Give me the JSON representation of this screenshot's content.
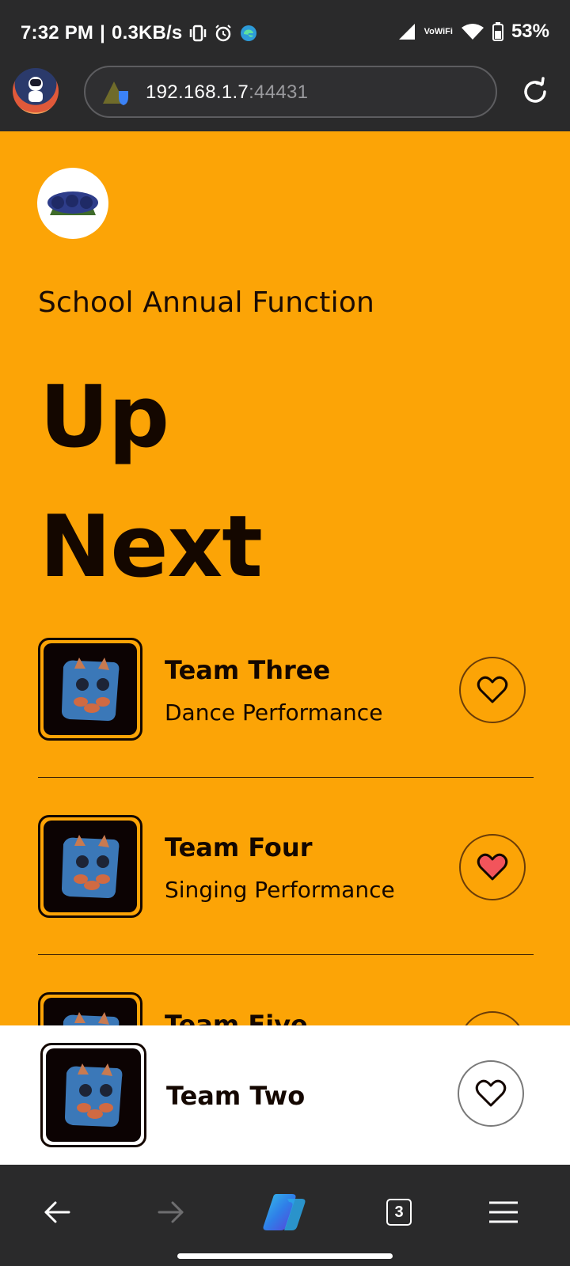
{
  "status_bar": {
    "time": "7:32 PM",
    "speed": "0.3KB/s",
    "volte_top": "Vo",
    "volte_bottom": "WiFi",
    "battery": "53%"
  },
  "browser": {
    "url_host": "192.168.1.7",
    "url_port": ":44431",
    "tab_count": "3"
  },
  "page": {
    "subtitle": "School Annual Function",
    "title_line1": "Up",
    "title_line2": "Next",
    "items": [
      {
        "title": "Team Three",
        "subtitle": "Dance Performance",
        "liked": false
      },
      {
        "title": "Team Four",
        "subtitle": "Singing Performance",
        "liked": true
      },
      {
        "title": "Team Five",
        "subtitle": "",
        "liked": false
      }
    ]
  },
  "now_playing": {
    "title": "Team Two",
    "liked": false
  },
  "icons": {
    "heart_outline": "heart-outline-icon",
    "heart_filled": "heart-filled-icon",
    "heart_fill_color": "#f2545b",
    "accent": "#fca406"
  }
}
